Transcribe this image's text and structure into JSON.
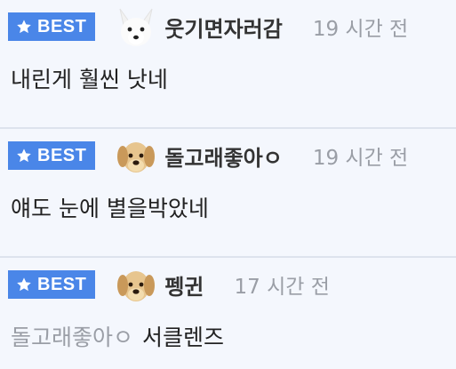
{
  "badge_label": "BEST",
  "comments": [
    {
      "avatar": "white-fox-avatar",
      "nickname": "웃기면자러감",
      "time": "19 시간 전",
      "mention": "",
      "text": "내린게 훨씬 낫네"
    },
    {
      "avatar": "puppy-avatar",
      "nickname": "돌고래좋아ㅇ",
      "time": "19 시간 전",
      "mention": "",
      "text": "얘도 눈에 별을박았네"
    },
    {
      "avatar": "puppy-avatar",
      "nickname": "펭귄",
      "time": "17 시간 전",
      "mention": "돌고래좋아ㅇ",
      "text": "서클렌즈"
    }
  ],
  "colors": {
    "badge": "#4a86e8",
    "background": "#f4f7fd",
    "muted": "#9a9ea6"
  }
}
